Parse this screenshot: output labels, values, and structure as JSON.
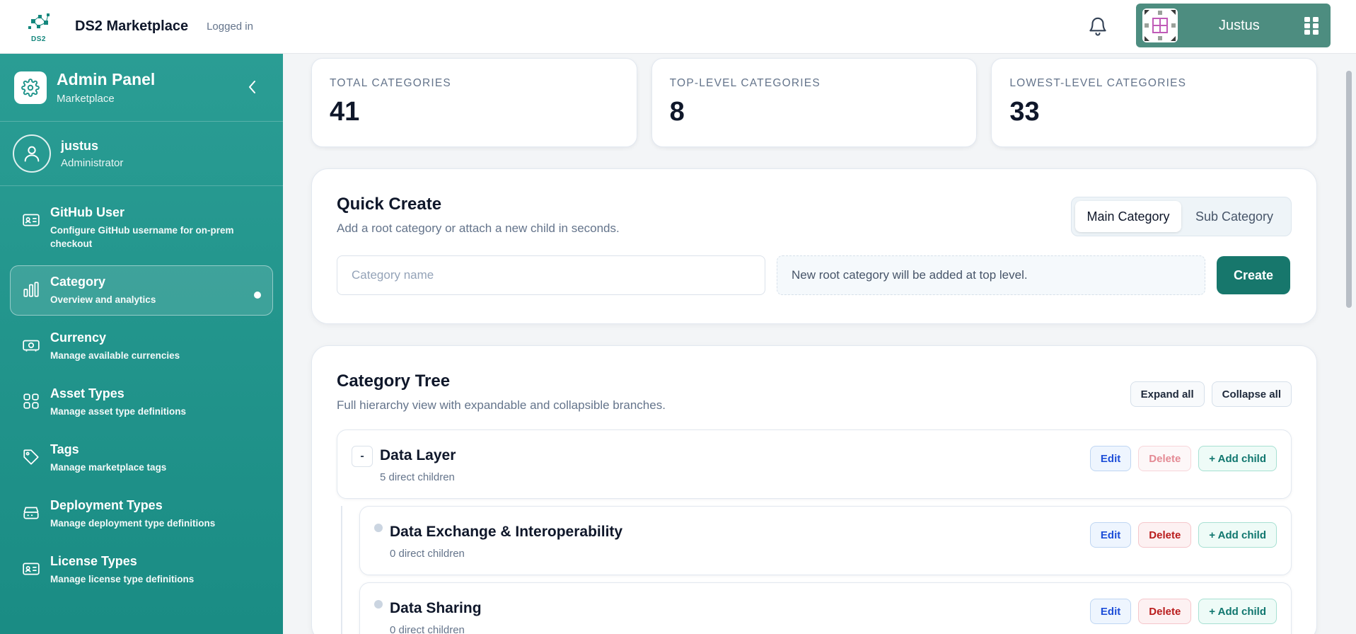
{
  "topbar": {
    "logo_text": "DS2",
    "brand": "DS2 Marketplace",
    "status": "Logged in",
    "user_name": "Justus"
  },
  "sidebar": {
    "title": "Admin Panel",
    "subtitle": "Marketplace",
    "user": {
      "name": "justus",
      "role": "Administrator"
    },
    "items": [
      {
        "label": "GitHub User",
        "desc": "Configure GitHub username for on-prem checkout",
        "icon": "id-card-icon",
        "active": false
      },
      {
        "label": "Category",
        "desc": "Overview and analytics",
        "icon": "bar-chart-icon",
        "active": true
      },
      {
        "label": "Currency",
        "desc": "Manage available currencies",
        "icon": "banknote-icon",
        "active": false
      },
      {
        "label": "Asset Types",
        "desc": "Manage asset type definitions",
        "icon": "grid-icon",
        "active": false
      },
      {
        "label": "Tags",
        "desc": "Manage marketplace tags",
        "icon": "tag-icon",
        "active": false
      },
      {
        "label": "Deployment Types",
        "desc": "Manage deployment type definitions",
        "icon": "server-icon",
        "active": false
      },
      {
        "label": "License Types",
        "desc": "Manage license type definitions",
        "icon": "id-card-icon",
        "active": false
      }
    ]
  },
  "stats": [
    {
      "label": "TOTAL CATEGORIES",
      "value": "41"
    },
    {
      "label": "TOP-LEVEL CATEGORIES",
      "value": "8"
    },
    {
      "label": "LOWEST-LEVEL CATEGORIES",
      "value": "33"
    }
  ],
  "quick_create": {
    "title": "Quick Create",
    "subtitle": "Add a root category or attach a new child in seconds.",
    "tabs": [
      "Main Category",
      "Sub Category"
    ],
    "active_tab": "Main Category",
    "name_placeholder": "Category name",
    "hint": "New root category will be added at top level.",
    "create_label": "Create"
  },
  "tree": {
    "title": "Category Tree",
    "subtitle": "Full hierarchy view with expandable and collapsible branches.",
    "expand_label": "Expand all",
    "collapse_label": "Collapse all",
    "edit_label": "Edit",
    "delete_label": "Delete",
    "add_child_label": "+ Add child",
    "root": {
      "toggle": "-",
      "name": "Data Layer",
      "count": "5 direct children"
    },
    "children": [
      {
        "name": "Data Exchange & Interoperability",
        "count": "0 direct children"
      },
      {
        "name": "Data Sharing",
        "count": "0 direct children"
      }
    ]
  },
  "colors": {
    "sidebar": "#1f948b",
    "accent": "#17776c",
    "user_pill": "#4d8d80"
  }
}
